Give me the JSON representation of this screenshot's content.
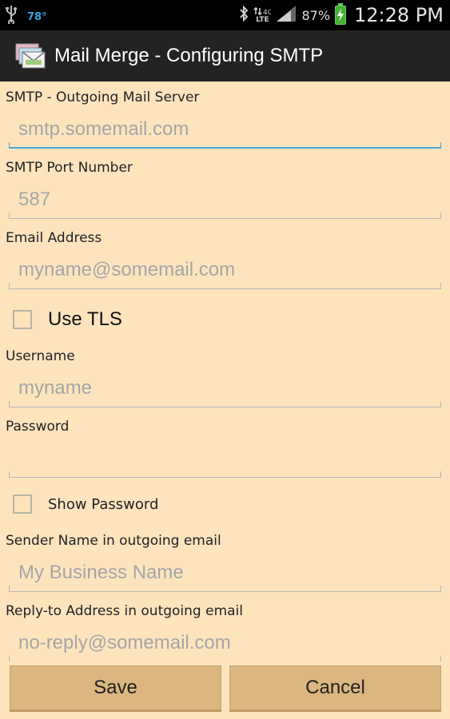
{
  "status_bar": {
    "temperature": "78°",
    "battery_percent": "87%",
    "time": "12:28 PM",
    "network_label": "LTE",
    "icons": [
      "usb-icon",
      "bluetooth-icon",
      "lte-icon",
      "signal-icon",
      "battery-charging-icon"
    ]
  },
  "action_bar": {
    "title": "Mail Merge - Configuring SMTP"
  },
  "form": {
    "smtp_server": {
      "label": "SMTP - Outgoing Mail Server",
      "placeholder": "smtp.somemail.com",
      "value": ""
    },
    "smtp_port": {
      "label": "SMTP Port Number",
      "placeholder": "587",
      "value": ""
    },
    "email": {
      "label": "Email Address",
      "placeholder": "myname@somemail.com",
      "value": ""
    },
    "use_tls": {
      "label": "Use TLS",
      "checked": false
    },
    "username": {
      "label": "Username",
      "placeholder": "myname",
      "value": ""
    },
    "password": {
      "label": "Password",
      "placeholder": "",
      "value": ""
    },
    "show_password": {
      "label": "Show Password",
      "checked": false
    },
    "sender_name": {
      "label": "Sender Name in outgoing email",
      "placeholder": "My Business Name",
      "value": ""
    },
    "reply_to": {
      "label": "Reply-to Address in outgoing email",
      "placeholder": "no-reply@somemail.com",
      "value": ""
    }
  },
  "buttons": {
    "save": "Save",
    "cancel": "Cancel"
  },
  "colors": {
    "background": "#fde4bd",
    "action_bar": "#232323",
    "focus_accent": "#4aa8d8",
    "button": "#dbb681"
  }
}
